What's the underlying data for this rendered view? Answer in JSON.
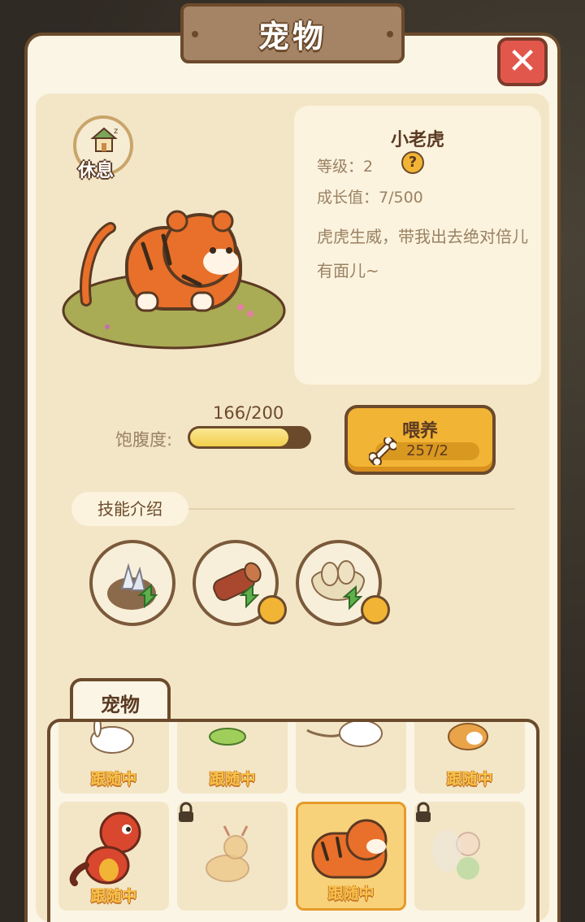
{
  "header": {
    "title": "宠物"
  },
  "status": {
    "rest_label": "休息"
  },
  "pet": {
    "name": "小老虎",
    "level_label": "等级：2",
    "growth_label": "成长值：7/500",
    "description": "虎虎生威，带我出去绝对倍儿有面儿~",
    "help_icon": "question-icon"
  },
  "satiety": {
    "label": "饱腹度:",
    "value_text": "166/200",
    "fraction": 0.83
  },
  "feed": {
    "label": "喂养",
    "count_text": "257/2"
  },
  "skills": {
    "tab_label": "技能介绍",
    "items": [
      {
        "icon": "crystal-icon",
        "locked": false
      },
      {
        "icon": "wood-log-icon",
        "locked": true
      },
      {
        "icon": "basket-icon",
        "locked": true
      }
    ]
  },
  "pets": {
    "tab_label": "宠物",
    "follow_label": "跟随中",
    "row1": [
      {
        "name": "rabbit",
        "following": true
      },
      {
        "name": "bird",
        "following": true
      },
      {
        "name": "mouse",
        "following": false
      },
      {
        "name": "shiba",
        "following": true
      }
    ],
    "row2": [
      {
        "name": "dinosaur",
        "following": true
      },
      {
        "name": "deer",
        "following": false,
        "locked": true
      },
      {
        "name": "tiger",
        "following": true,
        "selected": true
      },
      {
        "name": "fairy",
        "following": false,
        "locked": true
      }
    ]
  },
  "colors": {
    "accent": "#f2b434",
    "outline": "#6b4a2b",
    "close": "#e2574c"
  }
}
